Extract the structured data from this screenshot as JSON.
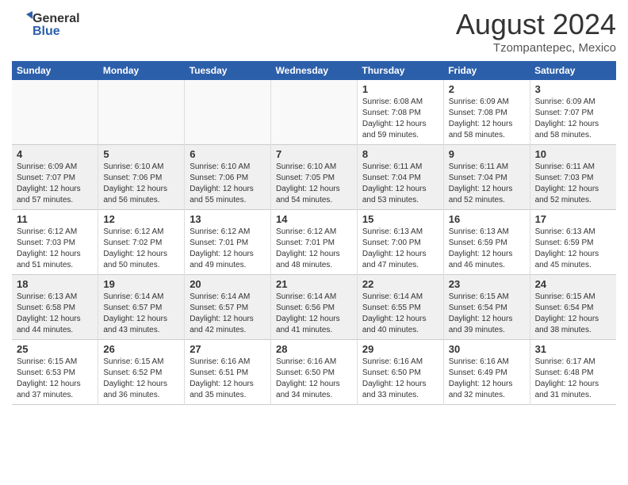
{
  "header": {
    "logo_general": "General",
    "logo_blue": "Blue",
    "month_year": "August 2024",
    "location": "Tzompantepec, Mexico"
  },
  "weekdays": [
    "Sunday",
    "Monday",
    "Tuesday",
    "Wednesday",
    "Thursday",
    "Friday",
    "Saturday"
  ],
  "weeks": [
    [
      {
        "day": "",
        "info": ""
      },
      {
        "day": "",
        "info": ""
      },
      {
        "day": "",
        "info": ""
      },
      {
        "day": "",
        "info": ""
      },
      {
        "day": "1",
        "info": "Sunrise: 6:08 AM\nSunset: 7:08 PM\nDaylight: 12 hours\nand 59 minutes."
      },
      {
        "day": "2",
        "info": "Sunrise: 6:09 AM\nSunset: 7:08 PM\nDaylight: 12 hours\nand 58 minutes."
      },
      {
        "day": "3",
        "info": "Sunrise: 6:09 AM\nSunset: 7:07 PM\nDaylight: 12 hours\nand 58 minutes."
      }
    ],
    [
      {
        "day": "4",
        "info": "Sunrise: 6:09 AM\nSunset: 7:07 PM\nDaylight: 12 hours\nand 57 minutes."
      },
      {
        "day": "5",
        "info": "Sunrise: 6:10 AM\nSunset: 7:06 PM\nDaylight: 12 hours\nand 56 minutes."
      },
      {
        "day": "6",
        "info": "Sunrise: 6:10 AM\nSunset: 7:06 PM\nDaylight: 12 hours\nand 55 minutes."
      },
      {
        "day": "7",
        "info": "Sunrise: 6:10 AM\nSunset: 7:05 PM\nDaylight: 12 hours\nand 54 minutes."
      },
      {
        "day": "8",
        "info": "Sunrise: 6:11 AM\nSunset: 7:04 PM\nDaylight: 12 hours\nand 53 minutes."
      },
      {
        "day": "9",
        "info": "Sunrise: 6:11 AM\nSunset: 7:04 PM\nDaylight: 12 hours\nand 52 minutes."
      },
      {
        "day": "10",
        "info": "Sunrise: 6:11 AM\nSunset: 7:03 PM\nDaylight: 12 hours\nand 52 minutes."
      }
    ],
    [
      {
        "day": "11",
        "info": "Sunrise: 6:12 AM\nSunset: 7:03 PM\nDaylight: 12 hours\nand 51 minutes."
      },
      {
        "day": "12",
        "info": "Sunrise: 6:12 AM\nSunset: 7:02 PM\nDaylight: 12 hours\nand 50 minutes."
      },
      {
        "day": "13",
        "info": "Sunrise: 6:12 AM\nSunset: 7:01 PM\nDaylight: 12 hours\nand 49 minutes."
      },
      {
        "day": "14",
        "info": "Sunrise: 6:12 AM\nSunset: 7:01 PM\nDaylight: 12 hours\nand 48 minutes."
      },
      {
        "day": "15",
        "info": "Sunrise: 6:13 AM\nSunset: 7:00 PM\nDaylight: 12 hours\nand 47 minutes."
      },
      {
        "day": "16",
        "info": "Sunrise: 6:13 AM\nSunset: 6:59 PM\nDaylight: 12 hours\nand 46 minutes."
      },
      {
        "day": "17",
        "info": "Sunrise: 6:13 AM\nSunset: 6:59 PM\nDaylight: 12 hours\nand 45 minutes."
      }
    ],
    [
      {
        "day": "18",
        "info": "Sunrise: 6:13 AM\nSunset: 6:58 PM\nDaylight: 12 hours\nand 44 minutes."
      },
      {
        "day": "19",
        "info": "Sunrise: 6:14 AM\nSunset: 6:57 PM\nDaylight: 12 hours\nand 43 minutes."
      },
      {
        "day": "20",
        "info": "Sunrise: 6:14 AM\nSunset: 6:57 PM\nDaylight: 12 hours\nand 42 minutes."
      },
      {
        "day": "21",
        "info": "Sunrise: 6:14 AM\nSunset: 6:56 PM\nDaylight: 12 hours\nand 41 minutes."
      },
      {
        "day": "22",
        "info": "Sunrise: 6:14 AM\nSunset: 6:55 PM\nDaylight: 12 hours\nand 40 minutes."
      },
      {
        "day": "23",
        "info": "Sunrise: 6:15 AM\nSunset: 6:54 PM\nDaylight: 12 hours\nand 39 minutes."
      },
      {
        "day": "24",
        "info": "Sunrise: 6:15 AM\nSunset: 6:54 PM\nDaylight: 12 hours\nand 38 minutes."
      }
    ],
    [
      {
        "day": "25",
        "info": "Sunrise: 6:15 AM\nSunset: 6:53 PM\nDaylight: 12 hours\nand 37 minutes."
      },
      {
        "day": "26",
        "info": "Sunrise: 6:15 AM\nSunset: 6:52 PM\nDaylight: 12 hours\nand 36 minutes."
      },
      {
        "day": "27",
        "info": "Sunrise: 6:16 AM\nSunset: 6:51 PM\nDaylight: 12 hours\nand 35 minutes."
      },
      {
        "day": "28",
        "info": "Sunrise: 6:16 AM\nSunset: 6:50 PM\nDaylight: 12 hours\nand 34 minutes."
      },
      {
        "day": "29",
        "info": "Sunrise: 6:16 AM\nSunset: 6:50 PM\nDaylight: 12 hours\nand 33 minutes."
      },
      {
        "day": "30",
        "info": "Sunrise: 6:16 AM\nSunset: 6:49 PM\nDaylight: 12 hours\nand 32 minutes."
      },
      {
        "day": "31",
        "info": "Sunrise: 6:17 AM\nSunset: 6:48 PM\nDaylight: 12 hours\nand 31 minutes."
      }
    ]
  ]
}
